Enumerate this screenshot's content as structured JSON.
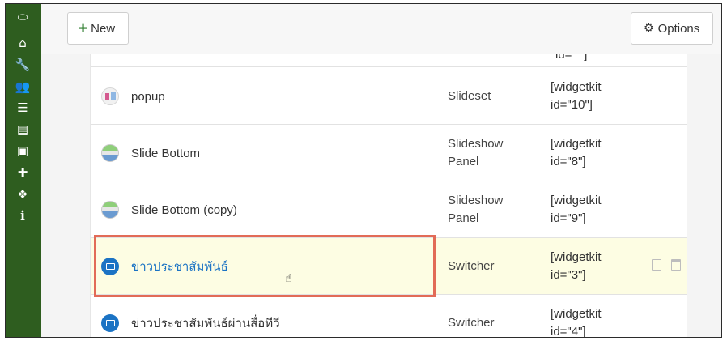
{
  "sidebar": {
    "items": [
      {
        "icon": "toggle-icon",
        "glyph": "⬭"
      },
      {
        "icon": "home-icon",
        "glyph": "⌂"
      },
      {
        "icon": "wrench-icon",
        "glyph": "🔧"
      },
      {
        "icon": "users-icon",
        "glyph": "👥"
      },
      {
        "icon": "list-icon",
        "glyph": "☰"
      },
      {
        "icon": "file-icon",
        "glyph": "▤"
      },
      {
        "icon": "image-icon",
        "glyph": "▣"
      },
      {
        "icon": "puzzle-icon",
        "glyph": "✚"
      },
      {
        "icon": "cubes-icon",
        "glyph": "❖"
      },
      {
        "icon": "info-icon",
        "glyph": "ℹ"
      }
    ]
  },
  "toolbar": {
    "new_label": "New",
    "options_label": "Options"
  },
  "table": {
    "cut_row_code": "id=\" \"]",
    "rows": [
      {
        "name": "popup",
        "type": "Slideset",
        "code_line1": "[widgetkit",
        "code_line2": "id=\"10\"]",
        "thumb": "grid",
        "highlight": false
      },
      {
        "name": "Slide Bottom",
        "type_line1": "Slideshow",
        "type_line2": "Panel",
        "code_line1": "[widgetkit",
        "code_line2": "id=\"8\"]",
        "thumb": "slide",
        "highlight": false
      },
      {
        "name": "Slide Bottom (copy)",
        "type_line1": "Slideshow",
        "type_line2": "Panel",
        "code_line1": "[widgetkit",
        "code_line2": "id=\"9\"]",
        "thumb": "slide",
        "highlight": false
      },
      {
        "name": "ข่าวประชาสัมพันธ์",
        "type": "Switcher",
        "code_line1": "[widgetkit",
        "code_line2": "id=\"3\"]",
        "thumb": "blue",
        "highlight": true
      },
      {
        "name": "ข่าวประชาสัมพันธ์ผ่านสื่อทีวี",
        "type": "Switcher",
        "code_line1": "[widgetkit",
        "code_line2": "id=\"4\"]",
        "thumb": "blue",
        "highlight": false
      }
    ]
  },
  "colors": {
    "sidebar": "#2e5d1f",
    "link": "#1b73c4",
    "highlight_row": "#fdfde3",
    "annotation_box": "#e26b57"
  }
}
